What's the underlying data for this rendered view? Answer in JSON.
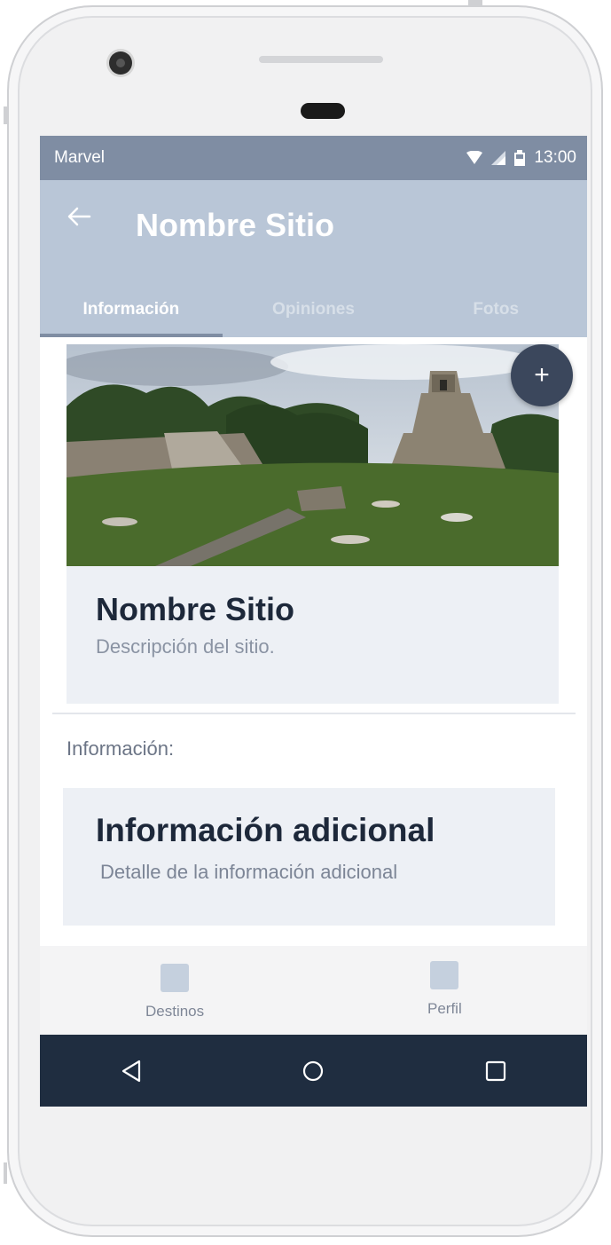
{
  "status_bar": {
    "carrier": "Marvel",
    "time": "13:00",
    "icons": [
      "wifi-icon",
      "signal-icon",
      "battery-icon"
    ]
  },
  "app_bar": {
    "back_icon": "arrow-left-icon",
    "title": "Nombre Sitio"
  },
  "tabs": [
    {
      "label": "Información",
      "active": true
    },
    {
      "label": "Opiniones",
      "active": false
    },
    {
      "label": "Fotos",
      "active": false
    }
  ],
  "hero": {
    "fab_label": "+"
  },
  "site_card": {
    "title": "Nombre Sitio",
    "description": "Descripción del sitio."
  },
  "info_section": {
    "label": "Información:"
  },
  "extra_card": {
    "title": "Información adicional",
    "detail": "Detalle de la información adicional"
  },
  "bottom_nav": [
    {
      "label": "Destinos"
    },
    {
      "label": "Perfil"
    }
  ],
  "colors": {
    "status_bar": "#7f8da3",
    "app_bar": "#b9c6d7",
    "fab": "#3b475c",
    "card": "#edf0f5",
    "system_nav": "#1f2d40"
  }
}
